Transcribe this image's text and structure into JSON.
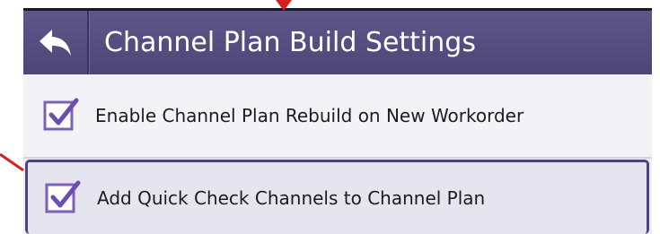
{
  "header": {
    "title": "Channel Plan Build Settings",
    "back_icon": "back-arrow-icon"
  },
  "settings": [
    {
      "label": "Enable Channel Plan Rebuild on New Workorder",
      "checked": true,
      "selected": false
    },
    {
      "label": "Add Quick Check Channels to Channel Plan",
      "checked": true,
      "selected": true
    }
  ],
  "colors": {
    "title_bar": "#564e80",
    "accent_check": "#6a4fb0",
    "annotation": "#d42020"
  }
}
